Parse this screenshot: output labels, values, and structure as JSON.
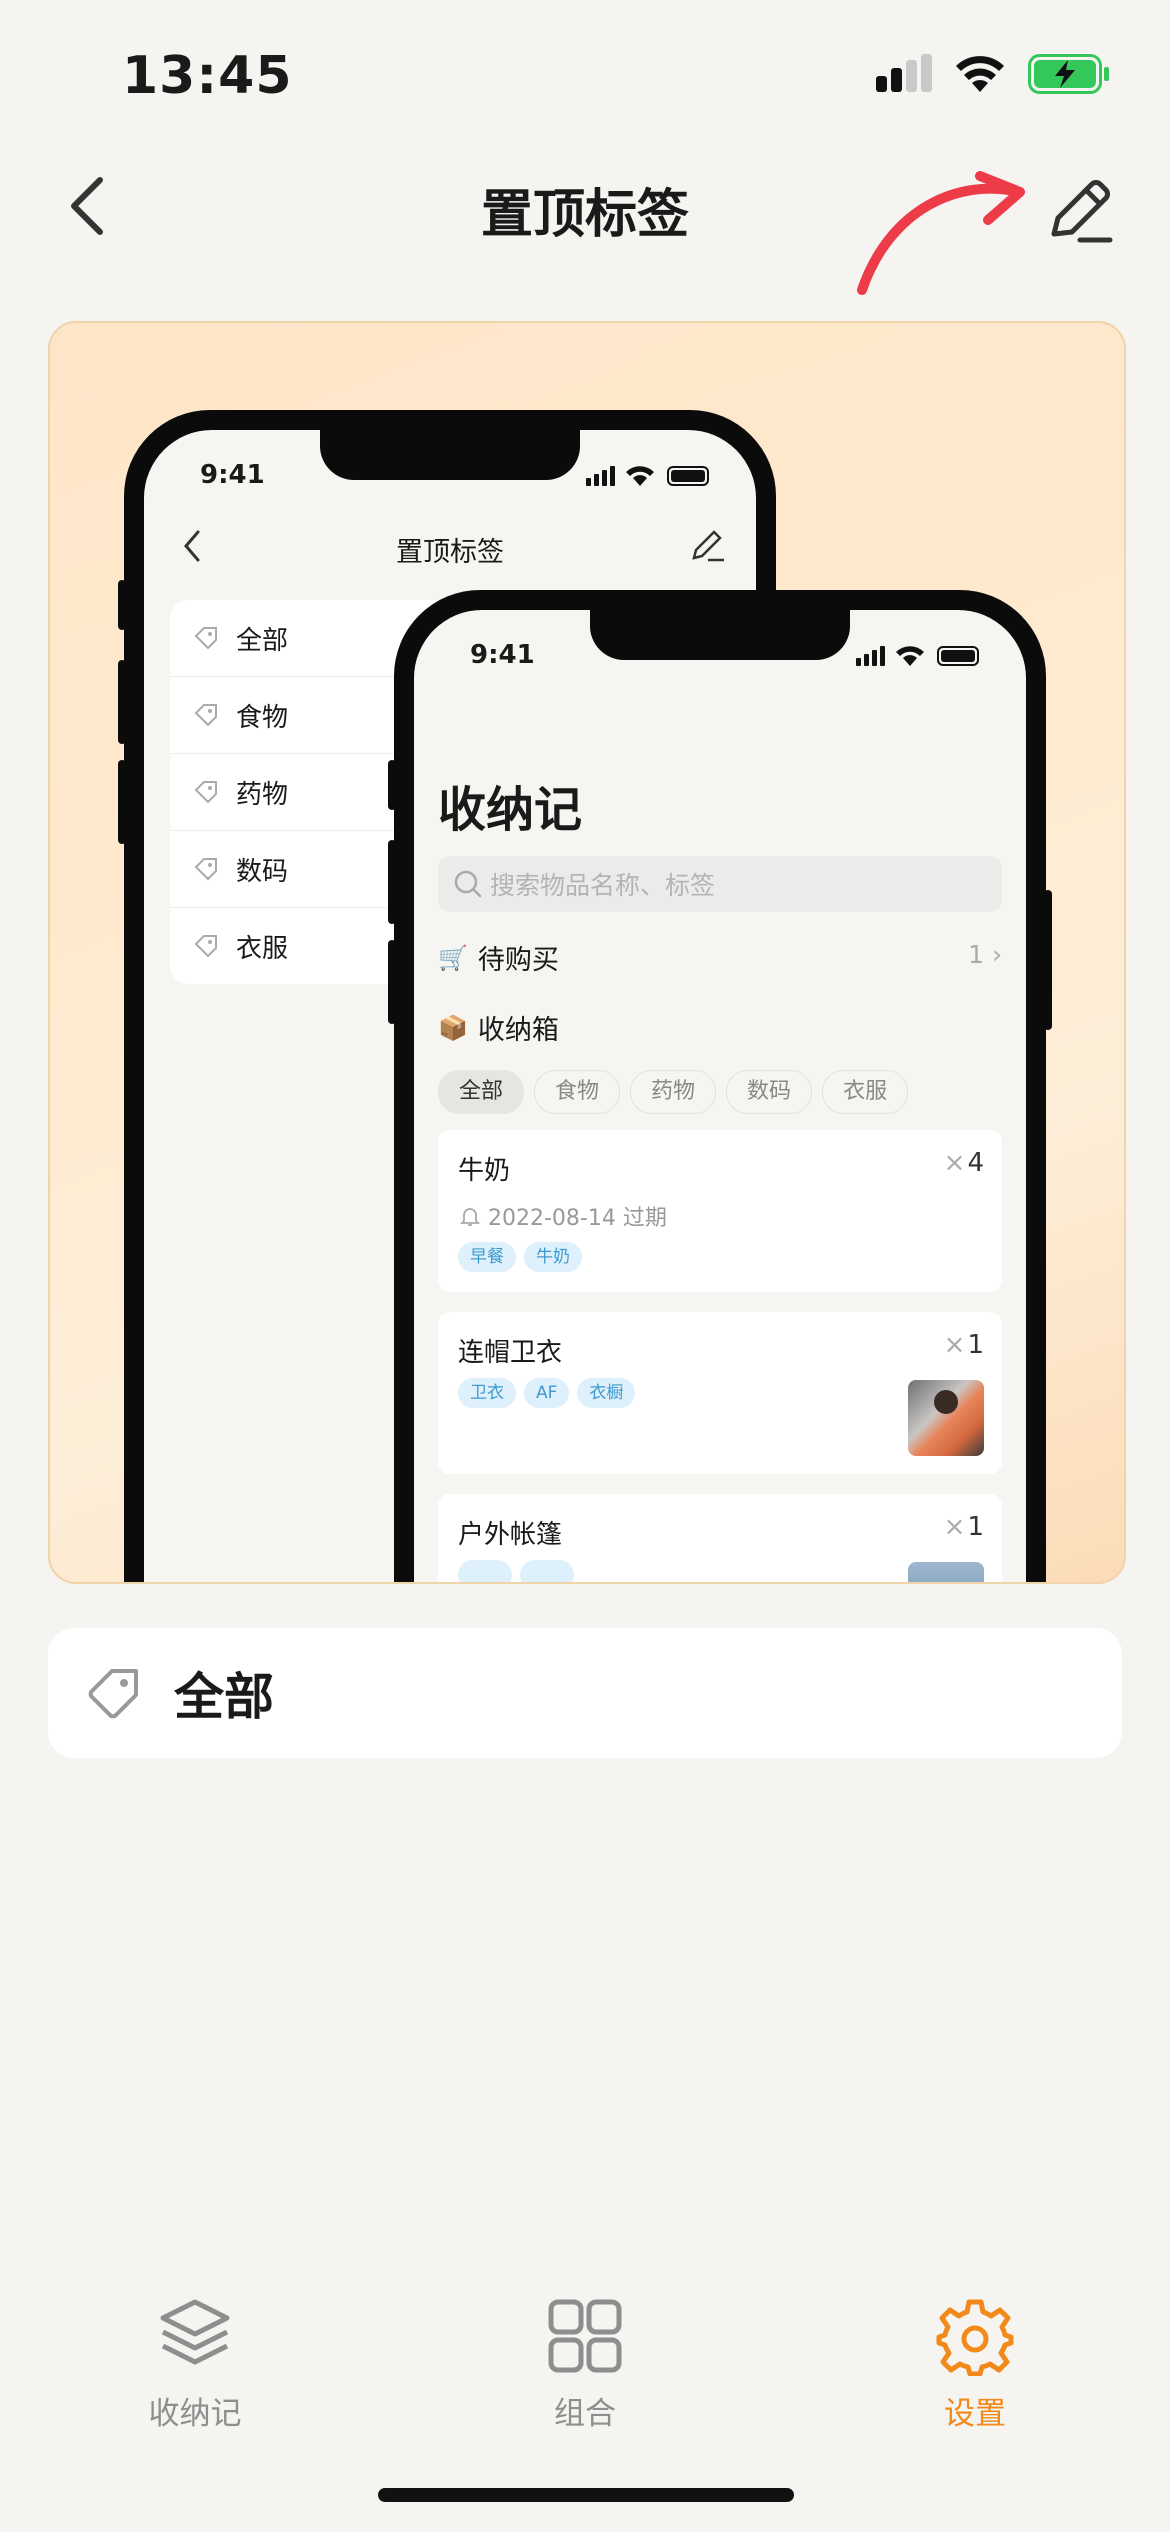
{
  "status_bar": {
    "time": "13:45"
  },
  "nav": {
    "title": "置顶标签"
  },
  "preview": {
    "back_phone": {
      "time": "9:41",
      "title": "置顶标签",
      "tags": [
        "全部",
        "食物",
        "药物",
        "数码",
        "衣服"
      ]
    },
    "front_phone": {
      "time": "9:41",
      "title": "收纳记",
      "search_placeholder": "搜索物品名称、标签",
      "to_buy": {
        "icon": "🛒",
        "label": "待购买",
        "count": "1"
      },
      "box": {
        "icon": "📦",
        "label": "收纳箱"
      },
      "filters": [
        "全部",
        "食物",
        "药物",
        "数码",
        "衣服"
      ],
      "items": [
        {
          "name": "牛奶",
          "qty": "4",
          "expiry": "2022-08-14 过期",
          "tags": [
            "早餐",
            "牛奶"
          ]
        },
        {
          "name": "连帽卫衣",
          "qty": "1",
          "tags": [
            "卫衣",
            "AF",
            "衣橱"
          ]
        },
        {
          "name": "户外帐篷",
          "qty": "1"
        }
      ]
    }
  },
  "pinned_tags": [
    {
      "label": "全部"
    }
  ],
  "tab_bar": {
    "items": [
      {
        "label": "收纳记",
        "icon": "layers-icon"
      },
      {
        "label": "组合",
        "icon": "grid-icon"
      },
      {
        "label": "设置",
        "icon": "gear-icon"
      }
    ],
    "active_index": 2,
    "active_color": "#f28a1a",
    "inactive_color": "#8e8e8e"
  },
  "colors": {
    "background": "#f6f4f1",
    "hint_arrow": "#ee3b48",
    "battery": "#34c759"
  }
}
